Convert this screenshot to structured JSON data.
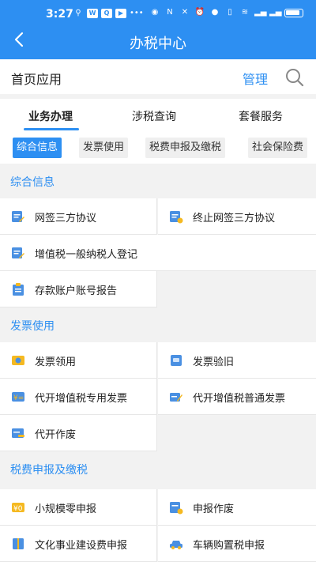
{
  "status_bar": {
    "time": "3:27",
    "battery": "77"
  },
  "header": {
    "title": "办税中心",
    "back_icon": "back-arrow-icon"
  },
  "home_bar": {
    "label": "首页应用",
    "manage": "管理",
    "search_icon": "search-icon"
  },
  "tabs": [
    {
      "label": "业务办理",
      "active": true
    },
    {
      "label": "涉税查询",
      "active": false
    },
    {
      "label": "套餐服务",
      "active": false
    }
  ],
  "chips": [
    {
      "label": "综合信息",
      "active": true
    },
    {
      "label": "发票使用",
      "active": false
    },
    {
      "label": "税费申报及缴税",
      "active": false
    },
    {
      "label": "社会保险费",
      "active": false
    }
  ],
  "sections": [
    {
      "title": "综合信息",
      "items": [
        {
          "label": "网签三方协议",
          "icon": "document-pen-icon"
        },
        {
          "label": "终止网签三方协议",
          "icon": "document-stop-icon"
        },
        {
          "label": "增值税一般纳税人登记",
          "icon": "document-pen-icon"
        },
        {
          "label": "存款账户账号报告",
          "icon": "clipboard-icon"
        }
      ]
    },
    {
      "title": "发票使用",
      "items": [
        {
          "label": "发票领用",
          "icon": "invoice-icon"
        },
        {
          "label": "发票验旧",
          "icon": "invoice-check-icon"
        },
        {
          "label": "代开增值税专用发票",
          "icon": "ticket-icon"
        },
        {
          "label": "代开增值税普通发票",
          "icon": "ticket-pen-icon"
        },
        {
          "label": "代开作废",
          "icon": "cancel-doc-icon"
        }
      ]
    },
    {
      "title": "税费申报及缴税",
      "items": [
        {
          "label": "小规模零申报",
          "icon": "yen-card-icon"
        },
        {
          "label": "申报作废",
          "icon": "declare-cancel-icon"
        },
        {
          "label": "文化事业建设费申报",
          "icon": "book-icon"
        },
        {
          "label": "车辆购置税申报",
          "icon": "car-icon"
        }
      ]
    }
  ],
  "colors": {
    "primary": "#2d8ff2",
    "icon_blue": "#4a90e2",
    "icon_yellow": "#f5b921"
  }
}
